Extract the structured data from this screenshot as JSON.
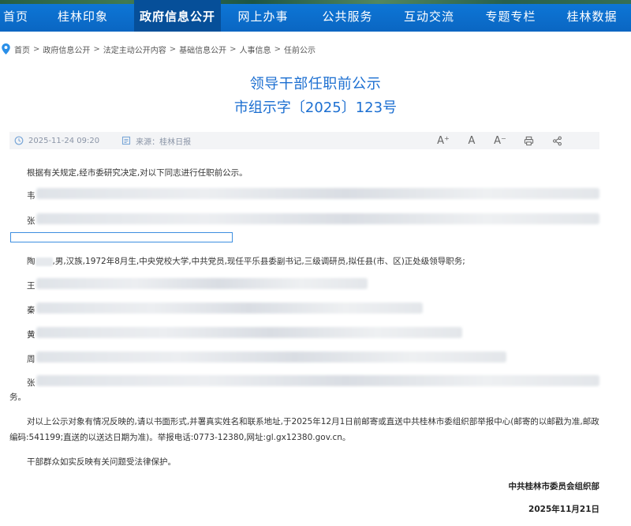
{
  "nav": {
    "items": [
      {
        "label": "首页"
      },
      {
        "label": "桂林印象"
      },
      {
        "label": "政府信息公开"
      },
      {
        "label": "网上办事"
      },
      {
        "label": "公共服务"
      },
      {
        "label": "互动交流"
      },
      {
        "label": "专题专栏"
      },
      {
        "label": "桂林数据"
      }
    ],
    "active_index": 2
  },
  "breadcrumb": {
    "items": [
      "首页",
      "政府信息公开",
      "法定主动公开内容",
      "基础信息公开",
      "人事信息",
      "任前公示"
    ],
    "separator": ">"
  },
  "article": {
    "title": "领导干部任职前公示",
    "doc_number": "市组示字〔2025〕123号",
    "date": "2025-11-24 09:20",
    "source": "来源：桂林日报",
    "tools": {
      "font_up": "A⁺",
      "font_normal": "A",
      "font_down": "A⁻"
    },
    "intro": "根据有关规定,经市委研究决定,对以下同志进行任职前公示。",
    "names": {
      "n1": "韦",
      "n2": "张",
      "n3": "陶",
      "n4": "王",
      "n5": "秦",
      "n6": "黄",
      "n7": "周",
      "n8": "张"
    },
    "person3_detail": ",男,汉族,1972年8月生,中央党校大学,中共党员,现任平乐县委副书记,三级调研员,拟任县(市、区)正处级领导职务;",
    "trailing": "务。",
    "contact_line1": "对以上公示对象有情况反映的,请以书面形式,并署真实姓名和联系地址,于2025年12月1日前邮寄或直送中共桂林市委组织部举报中心(邮寄的以邮戳为准,邮政",
    "contact_line2": "编码:541199;直送的以送达日期为准)。举报电话:0773-12380,网址:gl.gx12380.gov.cn。",
    "protection": "干部群众如实反映有关问题受法律保护。",
    "signature": "中共桂林市委员会组织部",
    "sign_date": "2025年11月21日"
  },
  "colors": {
    "nav_bg": "#0a66c2",
    "nav_active": "#064f99",
    "title": "#1c6fd1",
    "meta_bg": "#f3f4f6"
  }
}
